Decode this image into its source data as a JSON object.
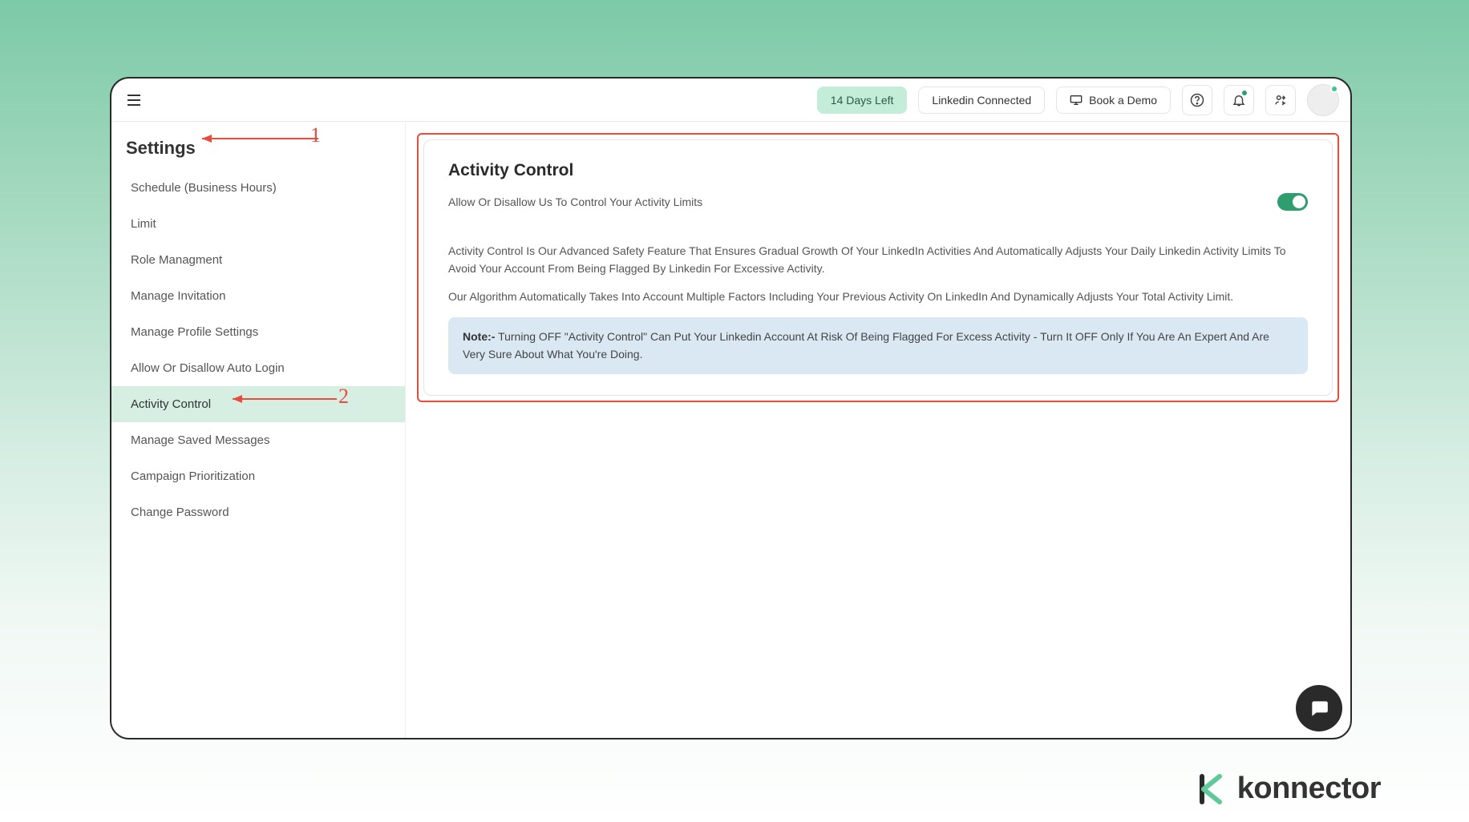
{
  "topbar": {
    "trial_badge": "14 Days Left",
    "linkedin_status": "Linkedin Connected",
    "book_demo": "Book a Demo"
  },
  "sidebar": {
    "title": "Settings",
    "items": [
      "Schedule (Business Hours)",
      "Limit",
      "Role Managment",
      "Manage Invitation",
      "Manage Profile Settings",
      "Allow Or Disallow Auto Login",
      "Activity Control",
      "Manage Saved Messages",
      "Campaign Prioritization",
      "Change Password"
    ],
    "active_index": 6
  },
  "panel": {
    "title": "Activity Control",
    "toggle_label": "Allow Or Disallow Us To Control Your Activity Limits",
    "desc1": "Activity Control Is Our Advanced Safety Feature That Ensures Gradual Growth Of Your LinkedIn Activities And Automatically Adjusts Your Daily Linkedin Activity Limits To Avoid Your Account From Being Flagged By Linkedin For Excessive Activity.",
    "desc2": "Our Algorithm Automatically Takes Into Account Multiple Factors Including Your Previous Activity On LinkedIn And Dynamically Adjusts Your Total Activity Limit.",
    "note_label": "Note:-",
    "note_text": " Turning OFF \"Activity Control\" Can Put Your Linkedin Account At Risk Of Being Flagged For Excess Activity - Turn It OFF Only If You Are An Expert And Are Very Sure About What You're Doing."
  },
  "annotations": {
    "a1": "1",
    "a2": "2"
  },
  "brand": {
    "name": "konnector"
  }
}
